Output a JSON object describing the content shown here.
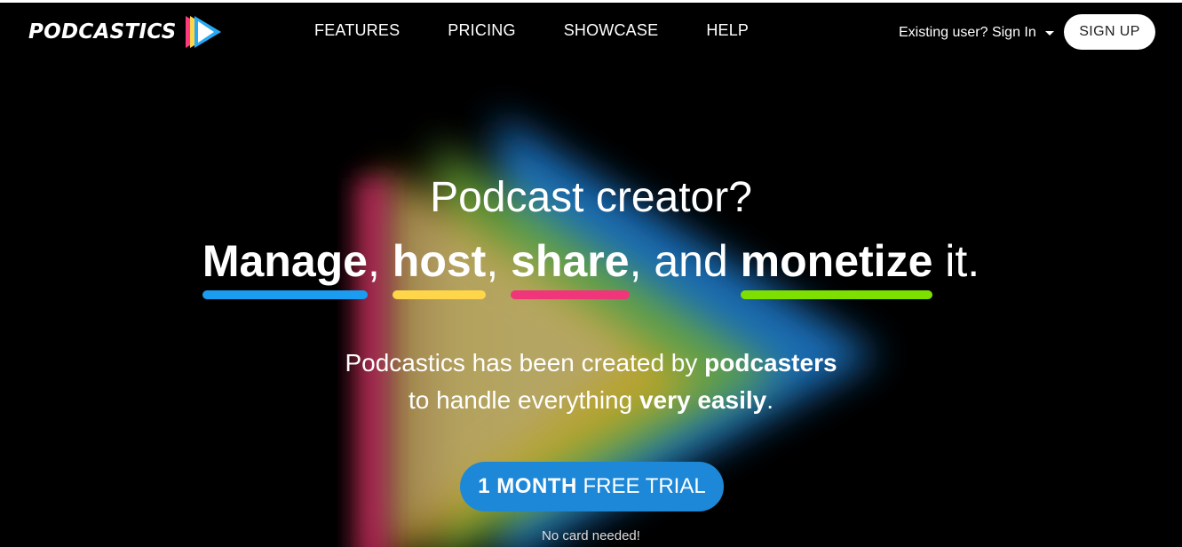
{
  "brand": {
    "name": "PODCASTICS"
  },
  "nav": [
    {
      "label": "FEATURES"
    },
    {
      "label": "PRICING"
    },
    {
      "label": "SHOWCASE"
    },
    {
      "label": "HELP"
    }
  ],
  "auth": {
    "signin_label": "Existing user? Sign In",
    "signup_label": "SIGN UP"
  },
  "hero": {
    "question": "Podcast creator?",
    "keywords": [
      {
        "word": "Manage",
        "after": ", ",
        "underline_color": "#1a9cf0"
      },
      {
        "word": "host",
        "after": ", ",
        "underline_color": "#ffd54a"
      },
      {
        "word": "share",
        "after": ", and ",
        "underline_color": "#f0357a"
      },
      {
        "word": "monetize",
        "after": " it.",
        "underline_color": "#7ee000"
      }
    ],
    "sub_line1_plain": "Podcastics has been created by ",
    "sub_line1_bold": "podcasters",
    "sub_line2_plain": "to handle everything ",
    "sub_line2_bold": "very easily",
    "sub_line2_end": "."
  },
  "cta": {
    "bold": "1 MONTH",
    "rest": " FREE TRIAL",
    "note": "No card needed!"
  },
  "colors": {
    "cta_bg": "#1e88d8",
    "background": "#000000"
  },
  "icons": {
    "logo_mark": "play-triangle-icon",
    "dropdown": "caret-down-icon"
  }
}
